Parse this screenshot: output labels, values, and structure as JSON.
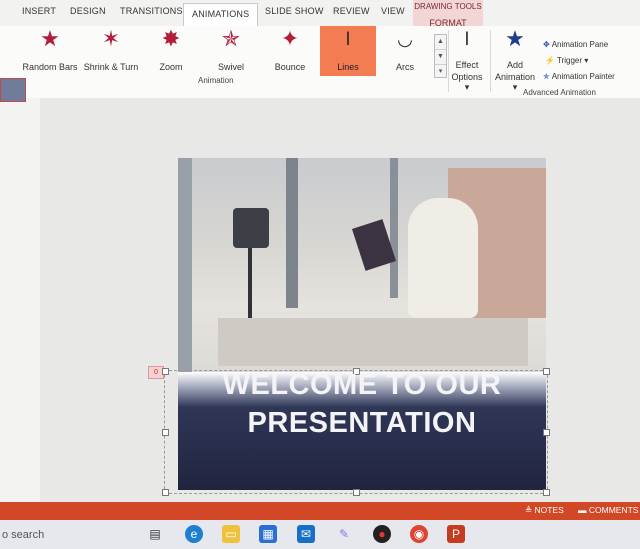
{
  "ribbon": {
    "tabs": [
      "INSERT",
      "DESIGN",
      "TRANSITIONS",
      "ANIMATIONS",
      "SLIDE SHOW",
      "REVIEW",
      "VIEW"
    ],
    "active_tab": "ANIMATIONS",
    "contextual": {
      "title": "DRAWING TOOLS",
      "tab": "FORMAT"
    },
    "effects": [
      "Random Bars",
      "Shrink & Turn",
      "Zoom",
      "Swivel",
      "Bounce",
      "Lines",
      "Arcs"
    ],
    "selected_effect": "Lines",
    "effect_options": {
      "line1": "Effect",
      "line2": "Options ▾"
    },
    "add_animation": {
      "line1": "Add",
      "line2": "Animation ▾"
    },
    "advanced": {
      "animation_pane": "Animation Pane",
      "trigger": "Trigger ▾",
      "animation_painter": "Animation Painter"
    },
    "group_labels": {
      "animation": "Animation",
      "advanced": "Advanced Animation"
    }
  },
  "slide": {
    "title_line1": "WELCOME TO OUR",
    "title_line2": "PRESENTATION",
    "animation_tag": "0"
  },
  "statusbar": {
    "notes": "NOTES",
    "comments": "COMMENTS"
  },
  "taskbar": {
    "search_placeholder": "o search"
  },
  "colors": {
    "accent": "#d24726",
    "selected_effect": "#f47c52",
    "star": "#b01e3a"
  }
}
